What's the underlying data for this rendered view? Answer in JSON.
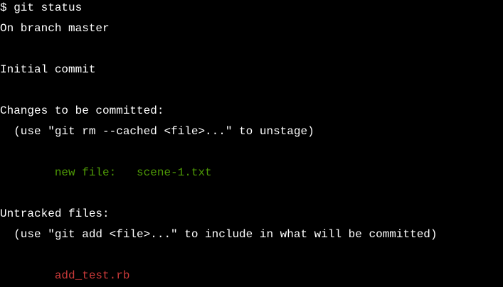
{
  "terminal": {
    "colors": {
      "background": "#000000",
      "text": "#ffffff",
      "staged": "#4e9a06",
      "untracked": "#cc3a3a"
    },
    "lines": [
      {
        "text": "$ git status",
        "style": "default"
      },
      {
        "text": "On branch master",
        "style": "default"
      },
      {
        "text": "",
        "style": "default"
      },
      {
        "text": "Initial commit",
        "style": "default"
      },
      {
        "text": "",
        "style": "default"
      },
      {
        "text": "Changes to be committed:",
        "style": "default"
      },
      {
        "text": "  (use \"git rm --cached <file>...\" to unstage)",
        "style": "default"
      },
      {
        "text": "",
        "style": "default"
      },
      {
        "text": "        new file:   scene-1.txt",
        "style": "green"
      },
      {
        "text": "",
        "style": "default"
      },
      {
        "text": "Untracked files:",
        "style": "default"
      },
      {
        "text": "  (use \"git add <file>...\" to include in what will be committed)",
        "style": "default"
      },
      {
        "text": "",
        "style": "default"
      },
      {
        "text": "        add_test.rb",
        "style": "red"
      }
    ]
  }
}
